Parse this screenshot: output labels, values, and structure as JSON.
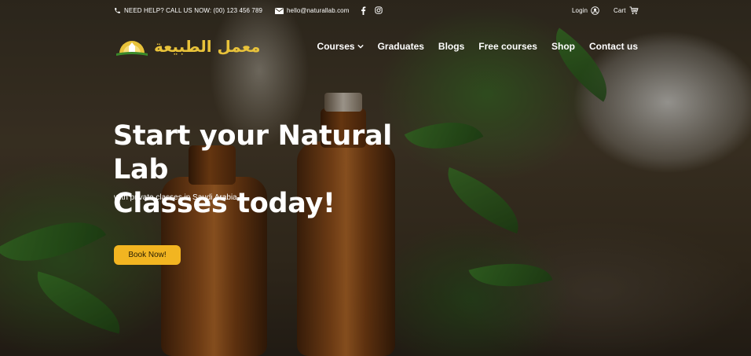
{
  "topbar": {
    "phone_text": "NEED HELP? CALL US NOW: (00) 123 456 789",
    "email_text": "hello@naturallab.com",
    "login_label": "Login",
    "cart_label": "Cart"
  },
  "header": {
    "logo_text": "معمل الطبيعة",
    "nav": [
      {
        "label": "Courses"
      },
      {
        "label": "Graduates"
      },
      {
        "label": "Blogs"
      },
      {
        "label": "Free courses"
      },
      {
        "label": "Shop"
      },
      {
        "label": "Contact us"
      }
    ]
  },
  "hero": {
    "headline_line1": "Start your Natural Lab",
    "headline_line2": "Classes today!",
    "subtitle": "with private classes in Saudi Arabia.",
    "cta_label": "Book Now!"
  },
  "colors": {
    "accent": "#f2b521",
    "logo_gold": "#e8c23a",
    "logo_green": "#3a8a2a"
  },
  "icons": [
    "phone-icon",
    "mail-icon",
    "facebook-icon",
    "instagram-icon",
    "user-icon",
    "cart-icon",
    "chevron-down-icon"
  ]
}
